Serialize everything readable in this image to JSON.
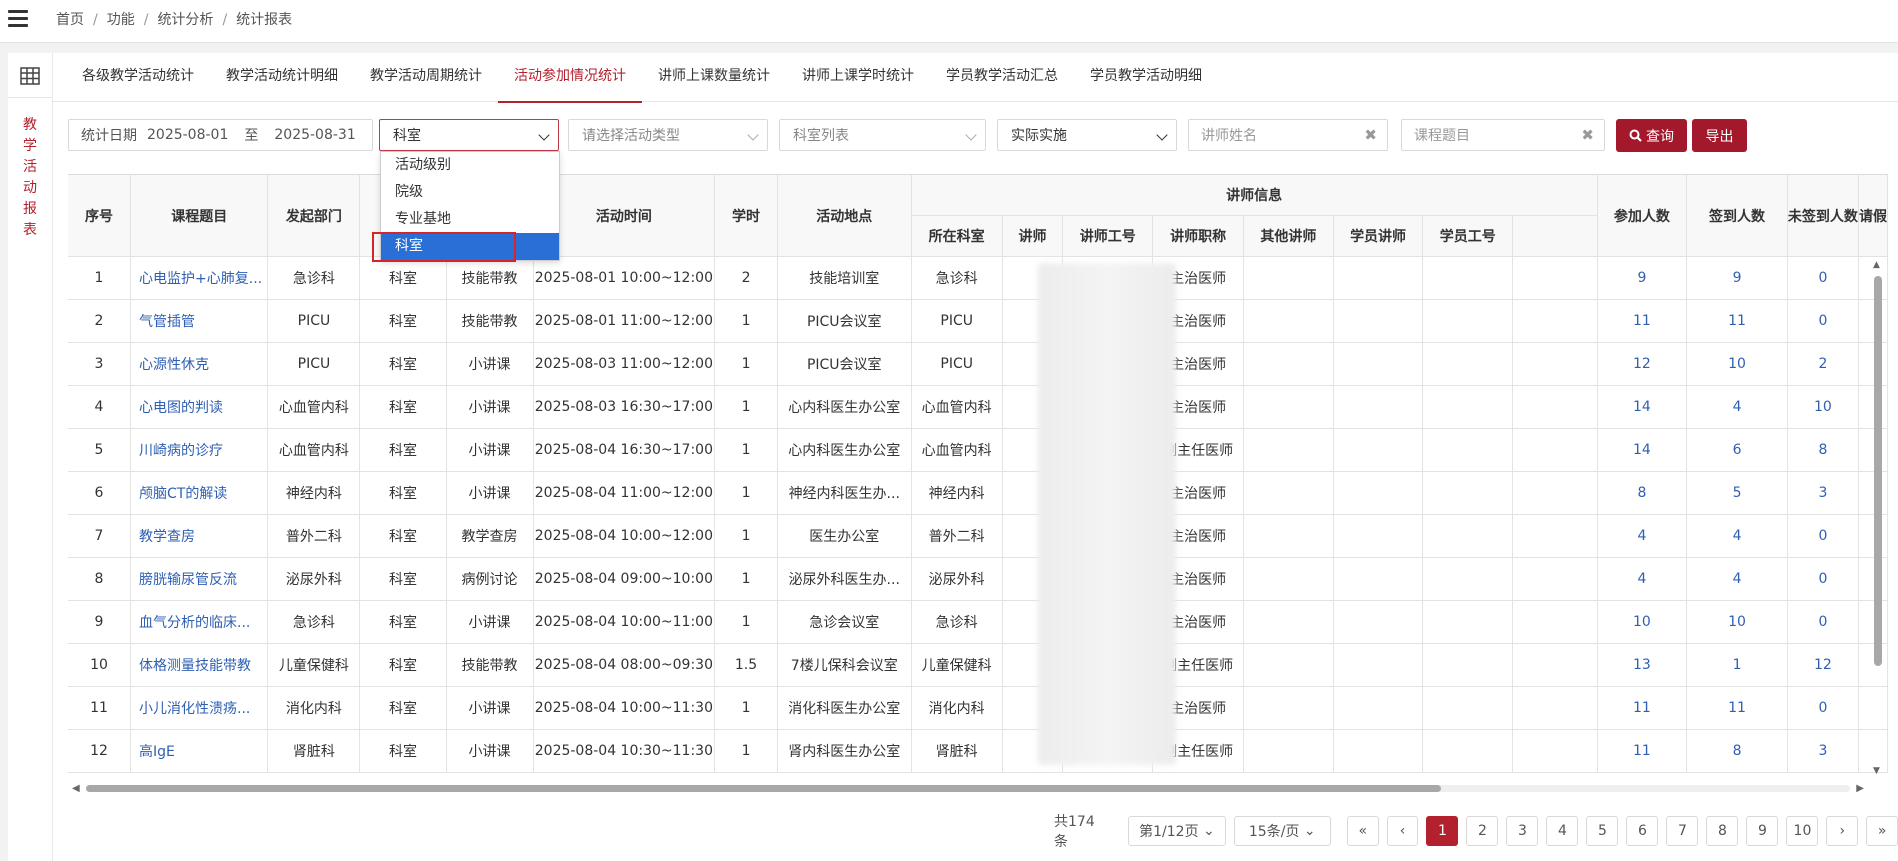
{
  "breadcrumb": [
    "首页",
    "功能",
    "统计分析",
    "统计报表"
  ],
  "side_label": "教学活动报表",
  "tabs": [
    {
      "label": "各级教学活动统计",
      "active": false
    },
    {
      "label": "教学活动统计明细",
      "active": false
    },
    {
      "label": "教学活动周期统计",
      "active": false
    },
    {
      "label": "活动参加情况统计",
      "active": true
    },
    {
      "label": "讲师上课数量统计",
      "active": false
    },
    {
      "label": "讲师上课学时统计",
      "active": false
    },
    {
      "label": "学员教学活动汇总",
      "active": false
    },
    {
      "label": "学员教学活动明细",
      "active": false
    }
  ],
  "filters": {
    "date_label": "统计日期",
    "date_from": "2025-08-01",
    "date_to_label": "至",
    "date_to": "2025-08-31",
    "level_value": "科室",
    "type_placeholder": "请选择活动类型",
    "dept_placeholder": "科室列表",
    "impl_value": "实际实施",
    "lecturer_placeholder": "讲师姓名",
    "course_placeholder": "课程题目",
    "query_label": "查询",
    "export_label": "导出"
  },
  "dropdown": {
    "options": [
      "活动级别",
      "院级",
      "专业基地",
      "科室"
    ],
    "selected_index": 3
  },
  "table": {
    "headers": {
      "seq": "序号",
      "course": "课程题目",
      "dept": "发起部门",
      "level": "",
      "type": "",
      "time": "活动时间",
      "hours": "学时",
      "place": "活动地点",
      "lecturer_group": "讲师信息",
      "lec_dept": "所在科室",
      "lec": "讲师",
      "lec_id": "讲师工号",
      "lec_title": "讲师职称",
      "other_lec": "其他讲师",
      "stu_lec": "学员讲师",
      "stu_id": "学员工号",
      "join": "参加人数",
      "signed": "签到人数",
      "unsigned": "未签到人数",
      "more": "请假"
    },
    "rows": [
      {
        "seq": "1",
        "course": "心电监护+心肺复...",
        "dept": "急诊科",
        "level": "科室",
        "type": "技能带教",
        "time": "2025-08-01 10:00~12:00",
        "hours": "2",
        "place": "技能培训室",
        "lec_dept": "急诊科",
        "lec_title": "主治医师",
        "join": "9",
        "signed": "9",
        "unsigned": "0"
      },
      {
        "seq": "2",
        "course": "气管插管",
        "dept": "PICU",
        "level": "科室",
        "type": "技能带教",
        "time": "2025-08-01 11:00~12:00",
        "hours": "1",
        "place": "PICU会议室",
        "lec_dept": "PICU",
        "lec_title": "主治医师",
        "join": "11",
        "signed": "11",
        "unsigned": "0"
      },
      {
        "seq": "3",
        "course": "心源性休克",
        "dept": "PICU",
        "level": "科室",
        "type": "小讲课",
        "time": "2025-08-03 11:00~12:00",
        "hours": "1",
        "place": "PICU会议室",
        "lec_dept": "PICU",
        "lec_title": "主治医师",
        "join": "12",
        "signed": "10",
        "unsigned": "2"
      },
      {
        "seq": "4",
        "course": "心电图的判读",
        "dept": "心血管内科",
        "level": "科室",
        "type": "小讲课",
        "time": "2025-08-03 16:30~17:00",
        "hours": "1",
        "place": "心内科医生办公室",
        "lec_dept": "心血管内科",
        "lec_title": "主治医师",
        "join": "14",
        "signed": "4",
        "unsigned": "10"
      },
      {
        "seq": "5",
        "course": "川崎病的诊疗",
        "dept": "心血管内科",
        "level": "科室",
        "type": "小讲课",
        "time": "2025-08-04 16:30~17:00",
        "hours": "1",
        "place": "心内科医生办公室",
        "lec_dept": "心血管内科",
        "lec_title": "副主任医师",
        "join": "14",
        "signed": "6",
        "unsigned": "8"
      },
      {
        "seq": "6",
        "course": "颅脑CT的解读",
        "dept": "神经内科",
        "level": "科室",
        "type": "小讲课",
        "time": "2025-08-04 11:00~12:00",
        "hours": "1",
        "place": "神经内科医生办...",
        "lec_dept": "神经内科",
        "lec_title": "主治医师",
        "join": "8",
        "signed": "5",
        "unsigned": "3"
      },
      {
        "seq": "7",
        "course": "教学查房",
        "dept": "普外二科",
        "level": "科室",
        "type": "教学查房",
        "time": "2025-08-04 10:00~12:00",
        "hours": "1",
        "place": "医生办公室",
        "lec_dept": "普外二科",
        "lec_title": "主治医师",
        "join": "4",
        "signed": "4",
        "unsigned": "0"
      },
      {
        "seq": "8",
        "course": "膀胱输尿管反流",
        "dept": "泌尿外科",
        "level": "科室",
        "type": "病例讨论",
        "time": "2025-08-04 09:00~10:00",
        "hours": "1",
        "place": "泌尿外科医生办...",
        "lec_dept": "泌尿外科",
        "lec_title": "主治医师",
        "join": "4",
        "signed": "4",
        "unsigned": "0"
      },
      {
        "seq": "9",
        "course": "血气分析的临床...",
        "dept": "急诊科",
        "level": "科室",
        "type": "小讲课",
        "time": "2025-08-04 10:00~11:00",
        "hours": "1",
        "place": "急诊会议室",
        "lec_dept": "急诊科",
        "lec_title": "主治医师",
        "join": "10",
        "signed": "10",
        "unsigned": "0"
      },
      {
        "seq": "10",
        "course": "体格测量技能带教",
        "dept": "儿童保健科",
        "level": "科室",
        "type": "技能带教",
        "time": "2025-08-04 08:00~09:30",
        "hours": "1.5",
        "place": "7楼儿保科会议室",
        "lec_dept": "儿童保健科",
        "lec_title": "副主任医师",
        "join": "13",
        "signed": "1",
        "unsigned": "12"
      },
      {
        "seq": "11",
        "course": "小儿消化性溃疡...",
        "dept": "消化内科",
        "level": "科室",
        "type": "小讲课",
        "time": "2025-08-04 10:00~11:30",
        "hours": "1",
        "place": "消化科医生办公室",
        "lec_dept": "消化内科",
        "lec_title": "主治医师",
        "join": "11",
        "signed": "11",
        "unsigned": "0"
      },
      {
        "seq": "12",
        "course": "高IgE",
        "dept": "肾脏科",
        "level": "科室",
        "type": "小讲课",
        "time": "2025-08-04 10:30~11:30",
        "hours": "1",
        "place": "肾内科医生办公室",
        "lec_dept": "肾脏科",
        "lec_title": "副主任医师",
        "join": "11",
        "signed": "8",
        "unsigned": "3"
      }
    ]
  },
  "pager": {
    "total": "共174条",
    "page_info": "第1/12页",
    "page_size": "15条/页",
    "first": "«",
    "prev": "‹",
    "pages": [
      "1",
      "2",
      "3",
      "4",
      "5",
      "6",
      "7",
      "8",
      "9",
      "10"
    ],
    "current": "1",
    "next": "›",
    "last": "»"
  },
  "colors": {
    "accent": "#a3192b",
    "link": "#2f5fb3",
    "dropdown_selected": "#2a6fd6"
  }
}
